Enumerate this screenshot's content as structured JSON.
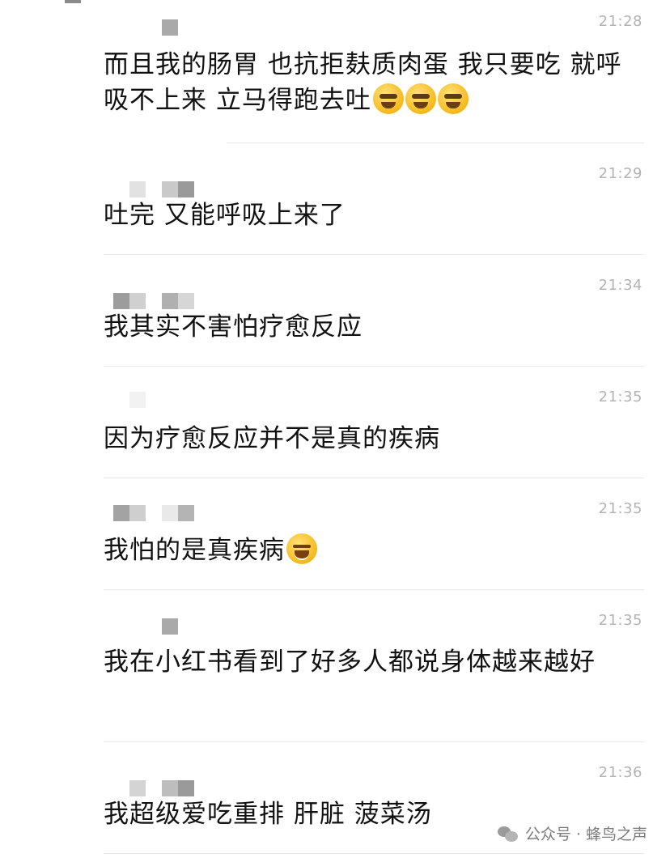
{
  "messages": [
    {
      "time": "21:28",
      "text": "而且我的肠胃 也抗拒麸质肉蛋 我只要吃 就呼吸不上来 立马得跑去吐",
      "emoji_count": 3,
      "emoji": "facepalm-emoji"
    },
    {
      "time": "21:29",
      "text": "吐完 又能呼吸上来了"
    },
    {
      "time": "21:34",
      "text": "我其实不害怕疗愈反应"
    },
    {
      "time": "21:35",
      "text": "因为疗愈反应并不是真的疾病"
    },
    {
      "time": "21:35",
      "text": "我怕的是真疾病",
      "emoji_count": 1,
      "emoji": "laughing-tears-emoji"
    },
    {
      "time": "21:35",
      "text": "我在小红书看到了好多人都说身体越来越好"
    },
    {
      "time": "21:36",
      "text": "我超级爱吃重排 肝脏 菠菜汤"
    }
  ],
  "watermark": {
    "icon": "wechat-icon",
    "text": "公众号 · 蜂鸟之声"
  },
  "colors": {
    "text": "#111111",
    "timestamp": "#b3b3b3",
    "divider": "#e9e9e9",
    "censor_dark": "#9c9c9c",
    "censor_light": "#d6d6d6"
  }
}
